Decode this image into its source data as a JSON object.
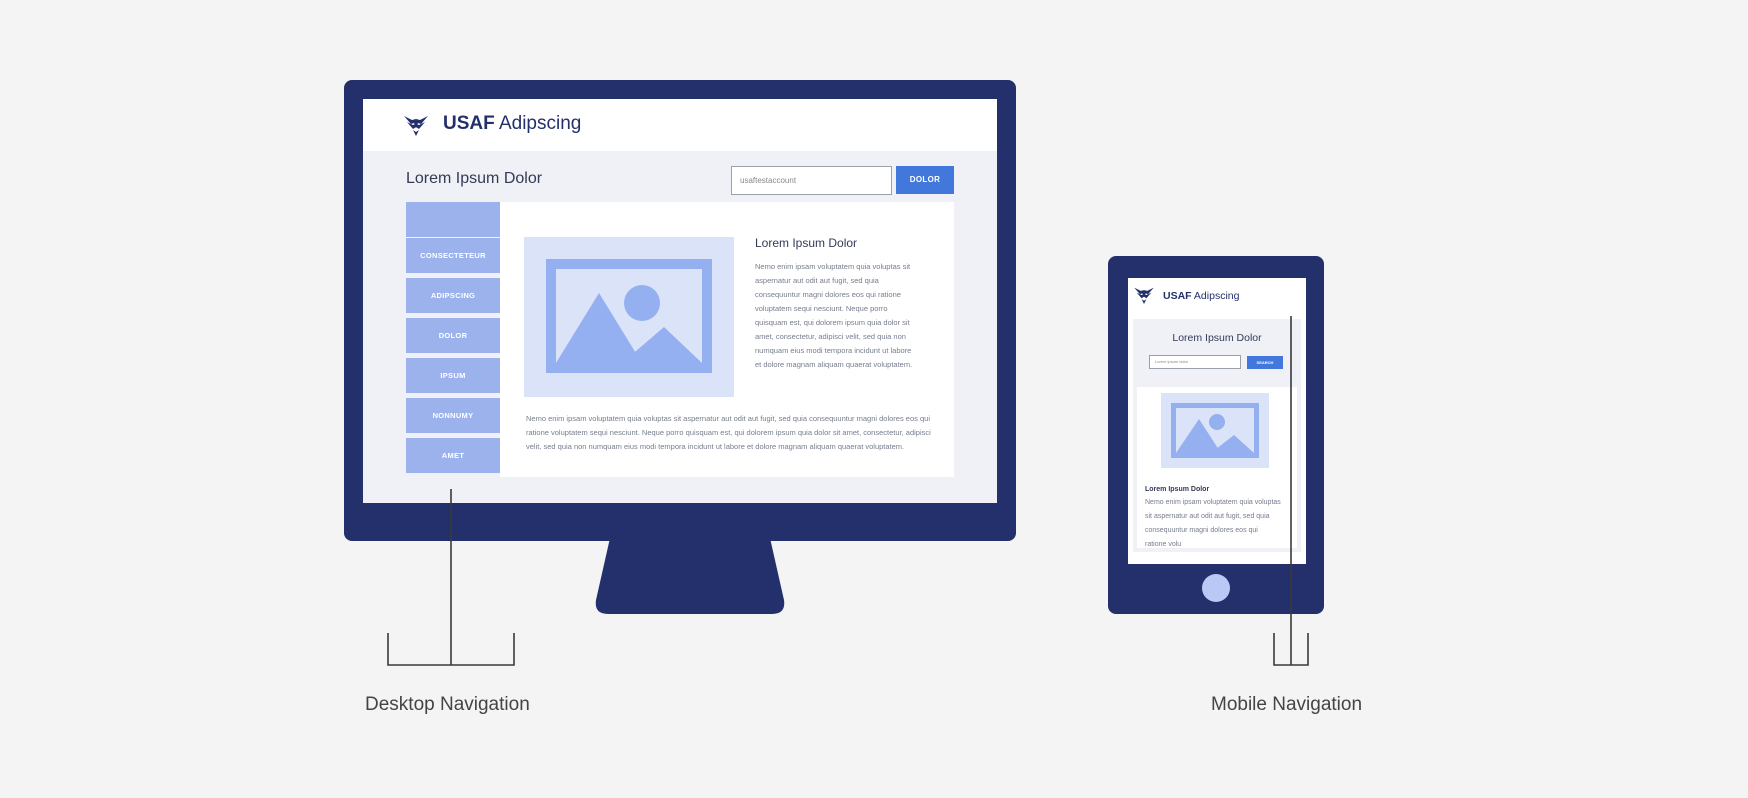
{
  "desktop": {
    "brand_bold": "USAF",
    "brand_rest": " Adipscing",
    "page_title": "Lorem Ipsum Dolor",
    "search_value": "usaftestaccount",
    "search_button": "DOLOR",
    "nav_items": [
      "",
      "CONSECTETEUR",
      "ADIPSCING",
      "DOLOR",
      "IPSUM",
      "NONNUMY",
      "AMET"
    ],
    "article_title": "Lorem Ipsum Dolor",
    "article_body": "Nemo enim ipsam voluptatem quia voluptas sit aspernatur aut odit aut fugit, sed quia consequuntur magni dolores eos qui ratione voluptatem sequi nesciunt. Neque porro quisquam est, qui dolorem ipsum quia dolor sit amet, consectetur, adipisci velit, sed quia non numquam eius modi tempora incidunt ut labore et dolore magnam aliquam quaerat voluptatem.",
    "article_body_2": "Nemo enim ipsam voluptatem quia voluptas sit aspernatur aut odit aut fugit, sed quia consequuntur magni dolores eos qui ratione voluptatem sequi nesciunt. Neque porro quisquam est, qui dolorem ipsum quia dolor sit amet, consectetur, adipisci velit, sed quia non numquam eius modi tempora incidunt ut labore et dolore magnam aliquam quaerat voluptatem."
  },
  "mobile": {
    "brand_bold": "USAF",
    "brand_rest": " Adipscing",
    "page_title": "Lorem Ipsum Dolor",
    "search_value": "Lorem ipsum dolor",
    "search_button": "SEARCH",
    "article_title": "Lorem Ipsum Dolor",
    "article_body": "Nemo enim ipsam voluptatem quia voluptas sit aspernatur aut odit aut fugit, sed quia consequuntur magni dolores eos qui ratione volu"
  },
  "labels": {
    "desktop": "Desktop Navigation",
    "mobile": "Mobile Navigation"
  },
  "colors": {
    "frame": "#24306c",
    "accent": "#4277db",
    "nav_item": "#9bb2ec",
    "image_bg": "#dbe3f8",
    "image_fg": "#94b0f0"
  }
}
